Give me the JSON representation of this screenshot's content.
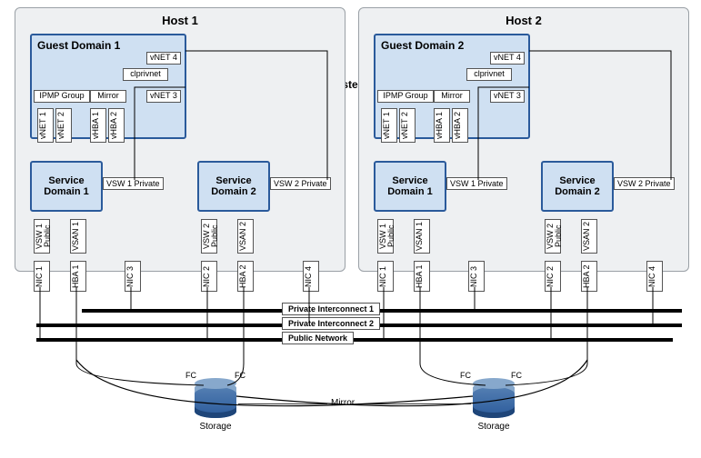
{
  "cluster_label": "Cluster",
  "hosts": [
    {
      "title": "Host 1",
      "guest": {
        "title": "Guest Domain 1",
        "ipmp": "IPMP Group",
        "mirror": "Mirror",
        "clprivnet": "clprivnet",
        "vnet3": "vNET 3",
        "vnet4": "vNET 4",
        "vnet1": "vNET 1",
        "vnet2": "vNET 2",
        "vhba1": "vHBA 1",
        "vhba2": "vHBA 2"
      },
      "service_domains": [
        {
          "title": "Service Domain 1",
          "priv_switch": "VSW 1 Private",
          "pub_switch": "VSW 1 Public",
          "vsan": "VSAN 1"
        },
        {
          "title": "Service Domain 2",
          "priv_switch": "VSW 2 Private",
          "pub_switch": "VSW 2 Public",
          "vsan": "VSAN 2"
        }
      ],
      "nics": {
        "nic1": "NIC 1",
        "hba1": "HBA 1",
        "nic3": "NIC 3",
        "nic2": "NIC 2",
        "hba2": "HBA 2",
        "nic4": "NIC 4"
      }
    },
    {
      "title": "Host 2",
      "guest": {
        "title": "Guest Domain 2",
        "ipmp": "IPMP Group",
        "mirror": "Mirror",
        "clprivnet": "clprivnet",
        "vnet3": "vNET 3",
        "vnet4": "vNET 4",
        "vnet1": "vNET 1",
        "vnet2": "vNET 2",
        "vhba1": "vHBA 1",
        "vhba2": "vHBA 2"
      },
      "service_domains": [
        {
          "title": "Service Domain 1",
          "priv_switch": "VSW 1 Private",
          "pub_switch": "VSW 1 Public",
          "vsan": "VSAN 1"
        },
        {
          "title": "Service Domain 2",
          "priv_switch": "VSW 2 Private",
          "pub_switch": "VSW 2 Public",
          "vsan": "VSAN 2"
        }
      ],
      "nics": {
        "nic1": "NIC 1",
        "hba1": "HBA 1",
        "nic3": "NIC 3",
        "nic2": "NIC 2",
        "hba2": "HBA 2",
        "nic4": "NIC 4"
      }
    }
  ],
  "buses": {
    "private1": "Private Interconnect 1",
    "private2": "Private Interconnect 2",
    "public": "Public Network"
  },
  "fc_label": "FC",
  "storage_label": "Storage",
  "mirror_label": "Mirror"
}
